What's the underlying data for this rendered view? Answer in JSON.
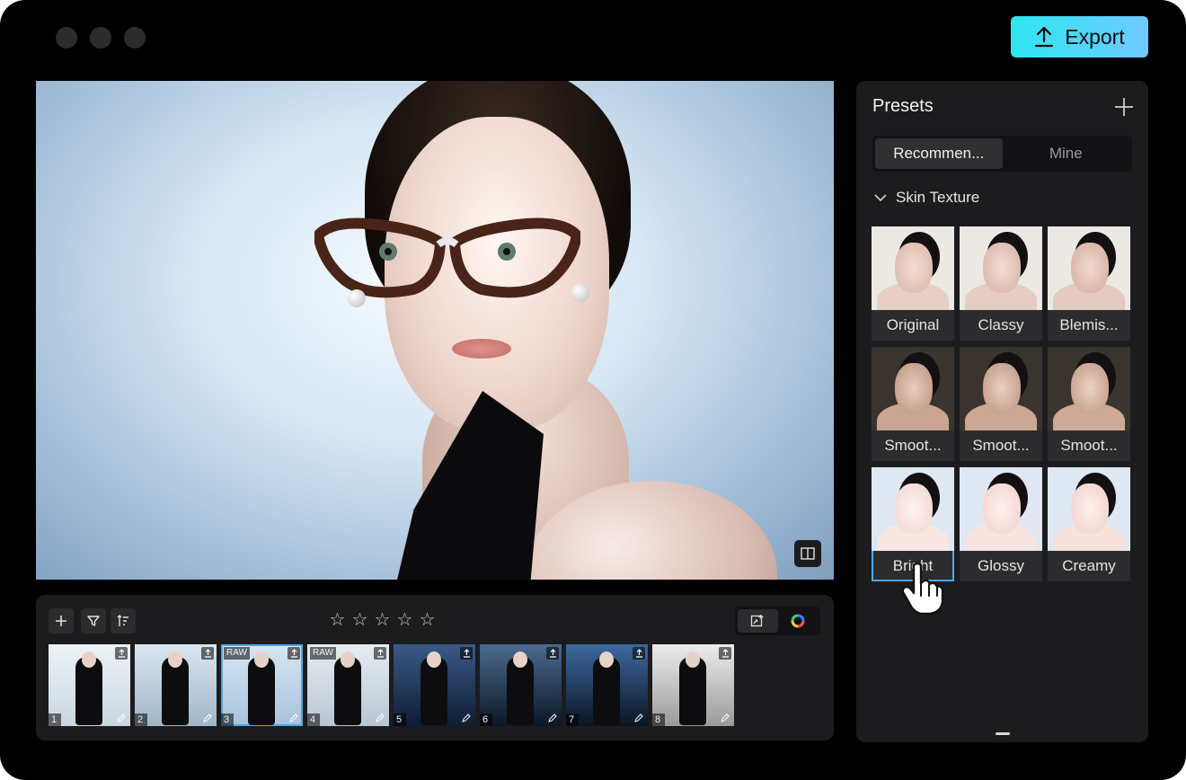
{
  "header": {
    "export_label": "Export"
  },
  "filmstrip": {
    "rating": 0,
    "thumbnails": [
      {
        "index": "1",
        "raw": "",
        "selected": false
      },
      {
        "index": "2",
        "raw": "",
        "selected": false
      },
      {
        "index": "3",
        "raw": "RAW",
        "selected": true
      },
      {
        "index": "4",
        "raw": "RAW",
        "selected": false
      },
      {
        "index": "5",
        "raw": "",
        "selected": false
      },
      {
        "index": "6",
        "raw": "",
        "selected": false
      },
      {
        "index": "7",
        "raw": "",
        "selected": false
      },
      {
        "index": "8",
        "raw": "",
        "selected": false
      }
    ]
  },
  "presets": {
    "title": "Presets",
    "tabs": [
      {
        "label": "Recommen...",
        "active": true
      },
      {
        "label": "Mine",
        "active": false
      }
    ],
    "section": "Skin Texture",
    "items": [
      {
        "label": "Original",
        "selected": false
      },
      {
        "label": "Classy",
        "selected": false
      },
      {
        "label": "Blemis...",
        "selected": false
      },
      {
        "label": "Smoot...",
        "selected": false
      },
      {
        "label": "Smoot...",
        "selected": false
      },
      {
        "label": "Smoot...",
        "selected": false
      },
      {
        "label": "Bright",
        "selected": true
      },
      {
        "label": "Glossy",
        "selected": false
      },
      {
        "label": "Creamy",
        "selected": false
      }
    ]
  },
  "colors": {
    "accent": "#4ea7e6",
    "export_gradient_start": "#2ee6f2",
    "export_gradient_end": "#6fc9ff",
    "panel": "#1c1c1e"
  },
  "icons": {
    "export": "upload-icon",
    "add": "plus-icon",
    "filter": "filter-icon",
    "sort": "sort-icon",
    "star": "star-icon",
    "compare": "compare-icon",
    "color": "color-wheel-icon",
    "section": "chevron-down-icon"
  }
}
